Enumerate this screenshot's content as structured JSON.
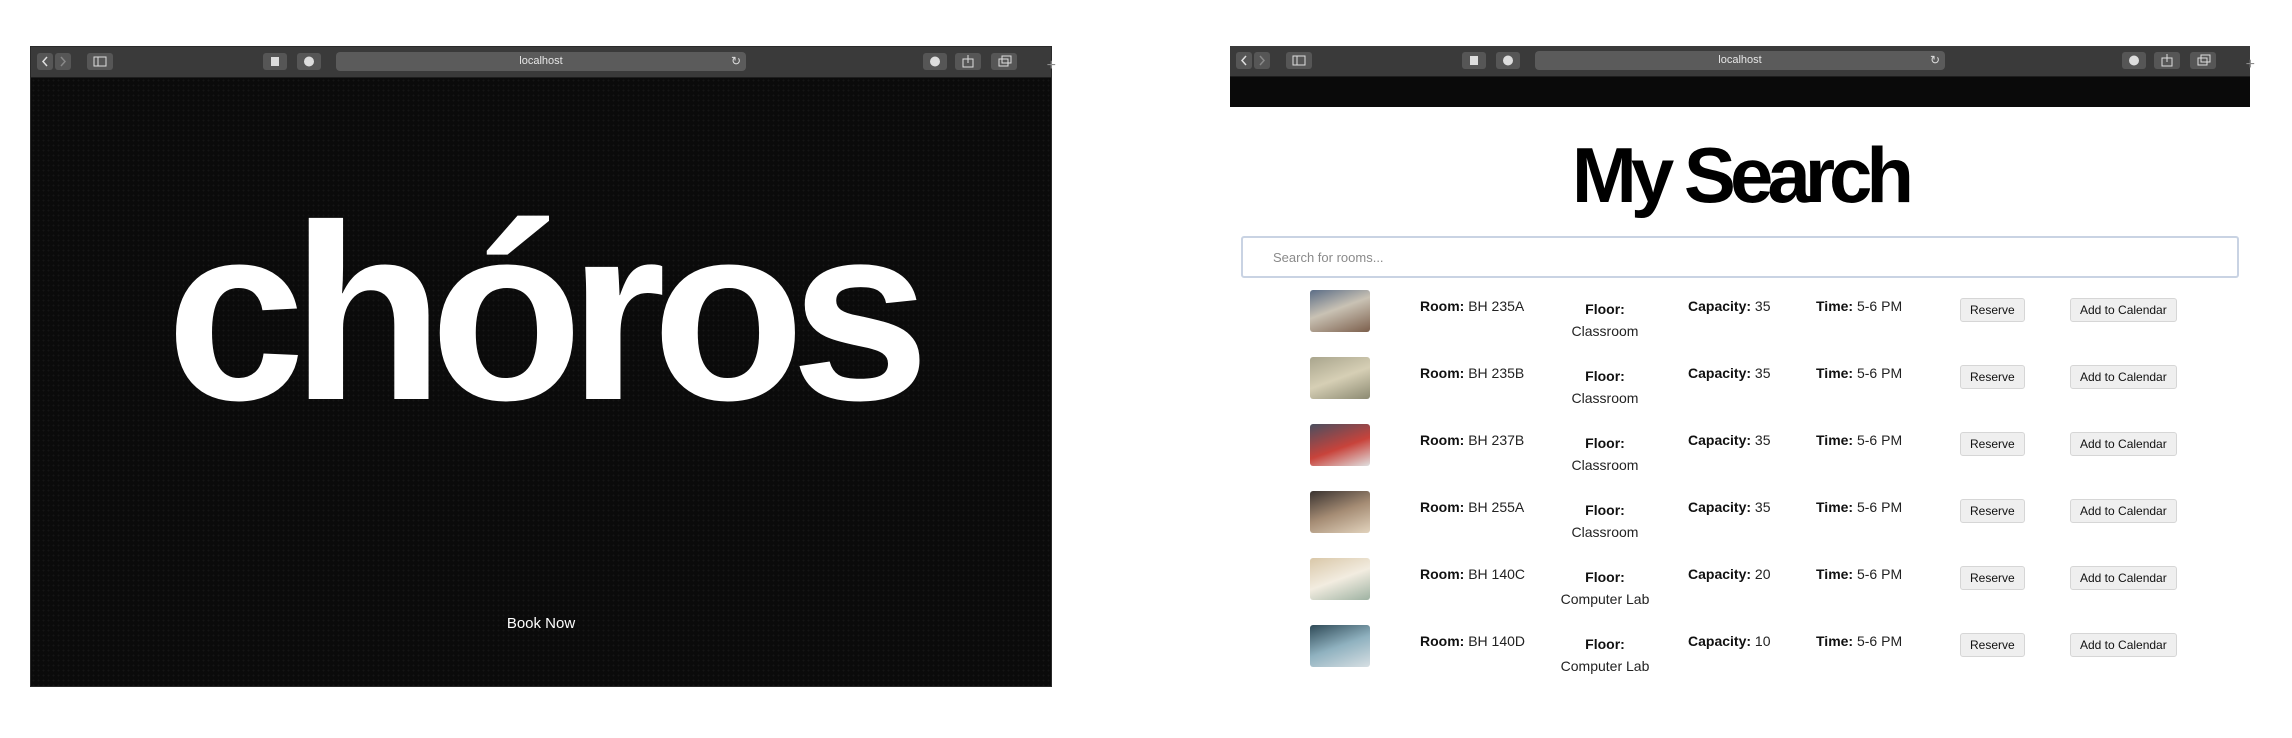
{
  "left_window": {
    "url": "localhost",
    "brand": "chóros",
    "book_now": "Book Now"
  },
  "right_window": {
    "url": "localhost",
    "title": "My Search",
    "search_placeholder": "Search for rooms...",
    "labels": {
      "room": "Room:",
      "floor": "Floor:",
      "capacity": "Capacity:",
      "time": "Time:"
    },
    "buttons": {
      "reserve": "Reserve",
      "calendar": "Add to Calendar"
    },
    "rooms": [
      {
        "room": "BH 235A",
        "floor": "Classroom",
        "capacity": "35",
        "time": "5-6 PM"
      },
      {
        "room": "BH 235B",
        "floor": "Classroom",
        "capacity": "35",
        "time": "5-6 PM"
      },
      {
        "room": "BH 237B",
        "floor": "Classroom",
        "capacity": "35",
        "time": "5-6 PM"
      },
      {
        "room": "BH 255A",
        "floor": "Classroom",
        "capacity": "35",
        "time": "5-6 PM"
      },
      {
        "room": "BH 140C",
        "floor": "Computer Lab",
        "capacity": "20",
        "time": "5-6 PM"
      },
      {
        "room": "BH 140D",
        "floor": "Computer Lab",
        "capacity": "10",
        "time": "5-6 PM"
      }
    ]
  }
}
